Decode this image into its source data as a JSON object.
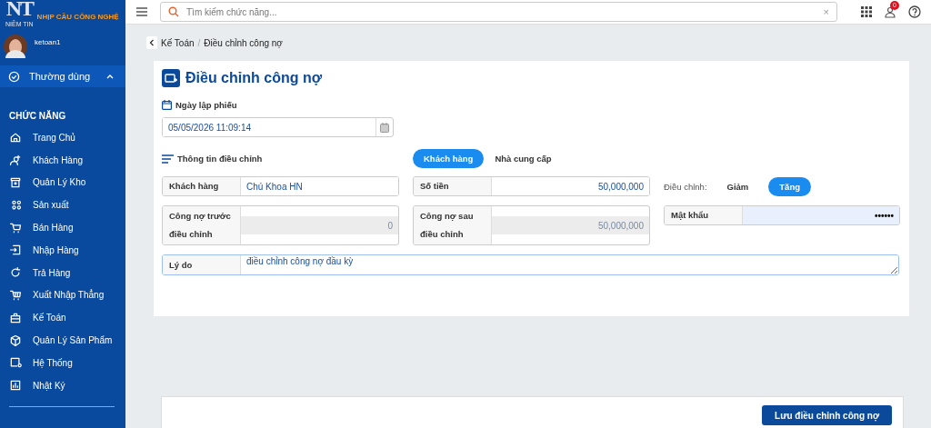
{
  "logo": {
    "mark": "NT",
    "name": "NIỀM TIN",
    "tagline": "NHỊP CẦU CÔNG NGHỆ"
  },
  "user": {
    "name": "ketoan1"
  },
  "favorites": {
    "label": "Thường dùng",
    "expanded": true
  },
  "sidebar": {
    "heading": "CHỨC NĂNG",
    "items": [
      {
        "label": "Trang Chủ",
        "selected": false
      },
      {
        "label": "Khách Hàng",
        "selected": false
      },
      {
        "label": "Quản Lý Kho",
        "selected": false
      },
      {
        "label": "Sản xuất",
        "selected": false
      },
      {
        "label": "Bán Hàng",
        "selected": false
      },
      {
        "label": "Nhập Hàng",
        "selected": false
      },
      {
        "label": "Trả Hàng",
        "selected": false
      },
      {
        "label": "Xuất Nhập Thẳng",
        "selected": false
      },
      {
        "label": "Kế Toán",
        "selected": false
      },
      {
        "label": "Quản Lý Sản Phẩm",
        "selected": false
      },
      {
        "label": "Hệ Thống",
        "selected": false
      },
      {
        "label": "Nhật Ký",
        "selected": false
      }
    ]
  },
  "search": {
    "placeholder": "Tìm kiếm chức năng...",
    "clear": "×"
  },
  "notifications": {
    "count": "0"
  },
  "breadcrumb": [
    "Kế Toán",
    "Điều chỉnh công nợ"
  ],
  "breadcrumb_separator": "/",
  "form": {
    "title": "Điều chỉnh công nợ",
    "date": {
      "label": "Ngày lập phiếu",
      "value": "05/05/2026 11:09:14"
    },
    "section": "Thông tin điều chỉnh",
    "party_tabs": [
      {
        "label": "Khách hàng",
        "selected": true
      },
      {
        "label": "Nhà cung cấp",
        "selected": false
      }
    ],
    "direction": {
      "label": "Điều chỉnh:",
      "options": [
        {
          "label": "Giảm",
          "selected": false
        },
        {
          "label": "Tăng",
          "selected": true
        }
      ]
    },
    "fields": [
      {
        "label": "Khách hàng",
        "value": "Chú Khoa HN",
        "kind": "text",
        "disabled": false
      },
      {
        "label": "Số tiền",
        "value": "50,000,000",
        "kind": "number",
        "disabled": false
      },
      {
        "label": "Công nợ trước điều chỉnh",
        "value": "0",
        "kind": "number",
        "disabled": true
      },
      {
        "label": "Công nợ sau điều chỉnh",
        "value": "50,000,000",
        "kind": "number",
        "disabled": true
      },
      {
        "label": "Mật khẩu",
        "value": "••••••",
        "kind": "password",
        "disabled": false
      }
    ],
    "reason": {
      "label": "Lý do",
      "value": "điều chỉnh công nợ đầu kỳ"
    }
  },
  "save_button": "Lưu điều chỉnh công nợ"
}
